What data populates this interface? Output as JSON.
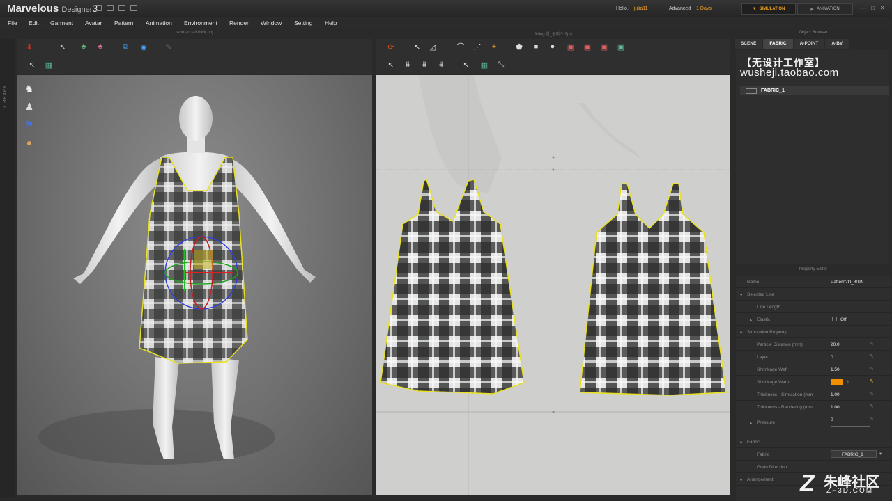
{
  "app": {
    "name": "Marvelous",
    "name_suffix": "Designer",
    "version": "3"
  },
  "header": {
    "hello": "Hello,",
    "user": "julia11",
    "plan": "Advanced",
    "days": "1 Days",
    "simulation_label": "SIMULATION",
    "animation_label": "ANIMATION"
  },
  "menu": [
    "File",
    "Edit",
    "Garment",
    "Avatar",
    "Pattern",
    "Animation",
    "Environment",
    "Render",
    "Window",
    "Setting",
    "Help"
  ],
  "panels": {
    "view3d_title": "woman tall thick.obj",
    "view2d_title": "fitting 한_원피스.Zprj",
    "library_label": "LIBRARY"
  },
  "object_browser": {
    "title": "Object Browser",
    "tabs": [
      "SCENE",
      "FABRIC",
      "A-POINT",
      "A-BV"
    ],
    "active_tab": "FABRIC",
    "watermark_cn": "【无设计工作室】",
    "watermark_url": "wusheji.taobao.com",
    "fabric_item": "FABRIC_1"
  },
  "property_editor": {
    "title": "Property Editor",
    "name_label": "Name",
    "name_value": "Pattern2D_8099",
    "selected_line": "Selected Line",
    "line_length": "Line Length",
    "elastic": "Elastic",
    "elastic_value": "Off",
    "sim_property": "Simulation Property",
    "particle_distance": "Particle Distance (mm)",
    "particle_distance_value": "20.0",
    "layer": "Layer",
    "layer_value": "0",
    "shrinkage_weft": "Shrinkage Weft",
    "shrinkage_weft_value": "1.50",
    "shrinkage_warp": "Shrinkage Warp",
    "thickness_sim": "Thickness - Simulation (mm",
    "thickness_sim_value": "1.00",
    "thickness_render": "Thickness - Rendering (mm",
    "thickness_render_value": "1.00",
    "pressure": "Pressure",
    "pressure_value": "0",
    "fabric_section": "Fabric",
    "fabric_label": "Fabric",
    "fabric_value": "FABRIC_1",
    "grain_direction": "Grain Direction",
    "arrangement": "Arrangement"
  },
  "site_logo": {
    "main": "朱峰社区",
    "sub": "ZF3D.COM"
  },
  "colors": {
    "accent": "#f0a020",
    "pattern_outline": "#e8e020",
    "plaid_dark": "#2a2c2b",
    "plaid_light": "#e8e8e8"
  }
}
